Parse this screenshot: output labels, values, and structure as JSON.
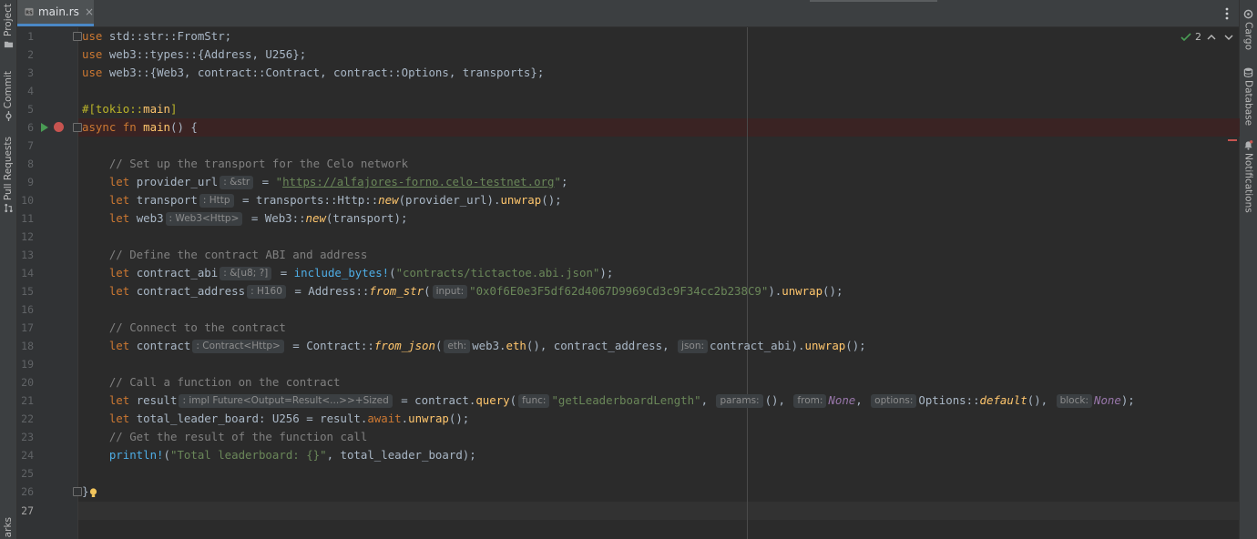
{
  "window": {
    "active_tab": {
      "filename": "main.rs",
      "close_label": "×",
      "file_icon": "rust-file-icon"
    },
    "more_icon": "vertical-ellipsis-icon"
  },
  "left_tool_window": {
    "items": [
      {
        "label": "Project",
        "icon": "folder-icon"
      },
      {
        "label": "Commit",
        "icon": "commit-icon"
      },
      {
        "label": "Pull Requests",
        "icon": "pull-request-icon"
      },
      {
        "label": "arks",
        "icon": ""
      }
    ]
  },
  "right_tool_window": {
    "items": [
      {
        "label": "Cargo",
        "icon": "cargo-icon"
      },
      {
        "label": "Database",
        "icon": "database-icon"
      },
      {
        "label": "Notifications",
        "icon": "bell-icon"
      }
    ]
  },
  "inspection": {
    "count": "2",
    "icon": "check-icon",
    "accent": "#499c54"
  },
  "editor": {
    "current_line": 27,
    "breakpoint_line": 6,
    "line_numbers": [
      "1",
      "2",
      "3",
      "4",
      "5",
      "6",
      "7",
      "8",
      "9",
      "10",
      "11",
      "12",
      "13",
      "14",
      "15",
      "16",
      "17",
      "18",
      "19",
      "20",
      "21",
      "22",
      "23",
      "24",
      "25",
      "26",
      "27"
    ],
    "colors": {
      "background": "#2b2b2b",
      "keyword": "#cc7832",
      "string": "#6a8759",
      "comment": "#808080",
      "function": "#ffc66d",
      "breakpoint": "#c75450",
      "run": "#499c54"
    },
    "code": {
      "l1": {
        "kw": "use",
        "rest": " std::str::FromStr;"
      },
      "l2": {
        "kw": "use",
        "rest": " web3::types::{Address, U256};"
      },
      "l3": {
        "kw": "use",
        "rest": " web3::{Web3, contract::Contract, contract::Options, transports};"
      },
      "l5": {
        "a": "#[tokio::",
        "b": "main",
        "c": "]"
      },
      "l6": {
        "kw1": "async",
        "kw2": "fn",
        "name": "main",
        "rest": "() {"
      },
      "l8": {
        "comment": "// Set up the transport for the Celo network"
      },
      "l9": {
        "kw": "let",
        "var": "provider_url",
        "hint": ": &str",
        "eq": " = ",
        "q1": "\"",
        "url": "https://alfajores-forno.celo-testnet.org",
        "q2": "\"",
        "end": ";"
      },
      "l10": {
        "kw": "let",
        "var": "transport",
        "hint": ": Http",
        "eq": " = transports::Http::",
        "fn": "new",
        "args": "(provider_url).",
        "m": "unwrap",
        "end": "();"
      },
      "l11": {
        "kw": "let",
        "var": "web3",
        "hint": ": Web3<Http>",
        "eq": " = Web3::",
        "fn": "new",
        "end": "(transport);"
      },
      "l13": {
        "comment": "// Define the contract ABI and address"
      },
      "l14": {
        "kw": "let",
        "var": "contract_abi",
        "hint": ": &[u8; ?]",
        "eq": " = ",
        "mac": "include_bytes!",
        "open": "(",
        "str": "\"contracts/tictactoe.abi.json\"",
        "end": ");"
      },
      "l15": {
        "kw": "let",
        "var": "contract_address",
        "hint": ": H160",
        "eq": " = Address::",
        "fn": "from_str",
        "open": "(",
        "phint": "input:",
        "str": "\"0x0f6E0e3F5df62d4067D9969Cd3c9F34cc2b238C9\"",
        "mid": ").",
        "m": "unwrap",
        "end": "();"
      },
      "l17": {
        "comment": "// Connect to the contract"
      },
      "l18": {
        "kw": "let",
        "var": "contract",
        "hint": ": Contract<Http>",
        "eq": " = Contract::",
        "fn": "from_json",
        "open": "(",
        "p1": "eth:",
        "a1": "web3.",
        "m1": "eth",
        "a1e": "(), contract_address, ",
        "p2": "json:",
        "a2": "contract_abi).",
        "m2": "unwrap",
        "end": "();"
      },
      "l20": {
        "comment": "// Call a function on the contract"
      },
      "l21": {
        "kw": "let",
        "var": "result",
        "hint": ": impl Future<Output=Result<...>>+Sized",
        "eq": " = contract.",
        "m": "query",
        "open": "(",
        "p1": "func:",
        "str": "\"getLeaderboardLength\"",
        "c1": ", ",
        "p2": "params:",
        "a2": "(), ",
        "p3": "from:",
        "none1": "None",
        "c3": ", ",
        "p4": "options:",
        "a4": "Options::",
        "fn4": "default",
        "a4e": "(), ",
        "p5": "block:",
        "none2": "None",
        "end": ");"
      },
      "l22": {
        "kw": "let",
        "rest1": " total_leader_board: U256 = result.",
        "aw": "await",
        "dot": ".",
        "m": "unwrap",
        "end": "();"
      },
      "l23": {
        "comment": "// Get the result of the function call"
      },
      "l24": {
        "mac": "println!",
        "open": "(",
        "str": "\"Total leaderboard: {}\"",
        "end": ", total_leader_board);"
      },
      "l26": {
        "brace": "}"
      }
    }
  }
}
